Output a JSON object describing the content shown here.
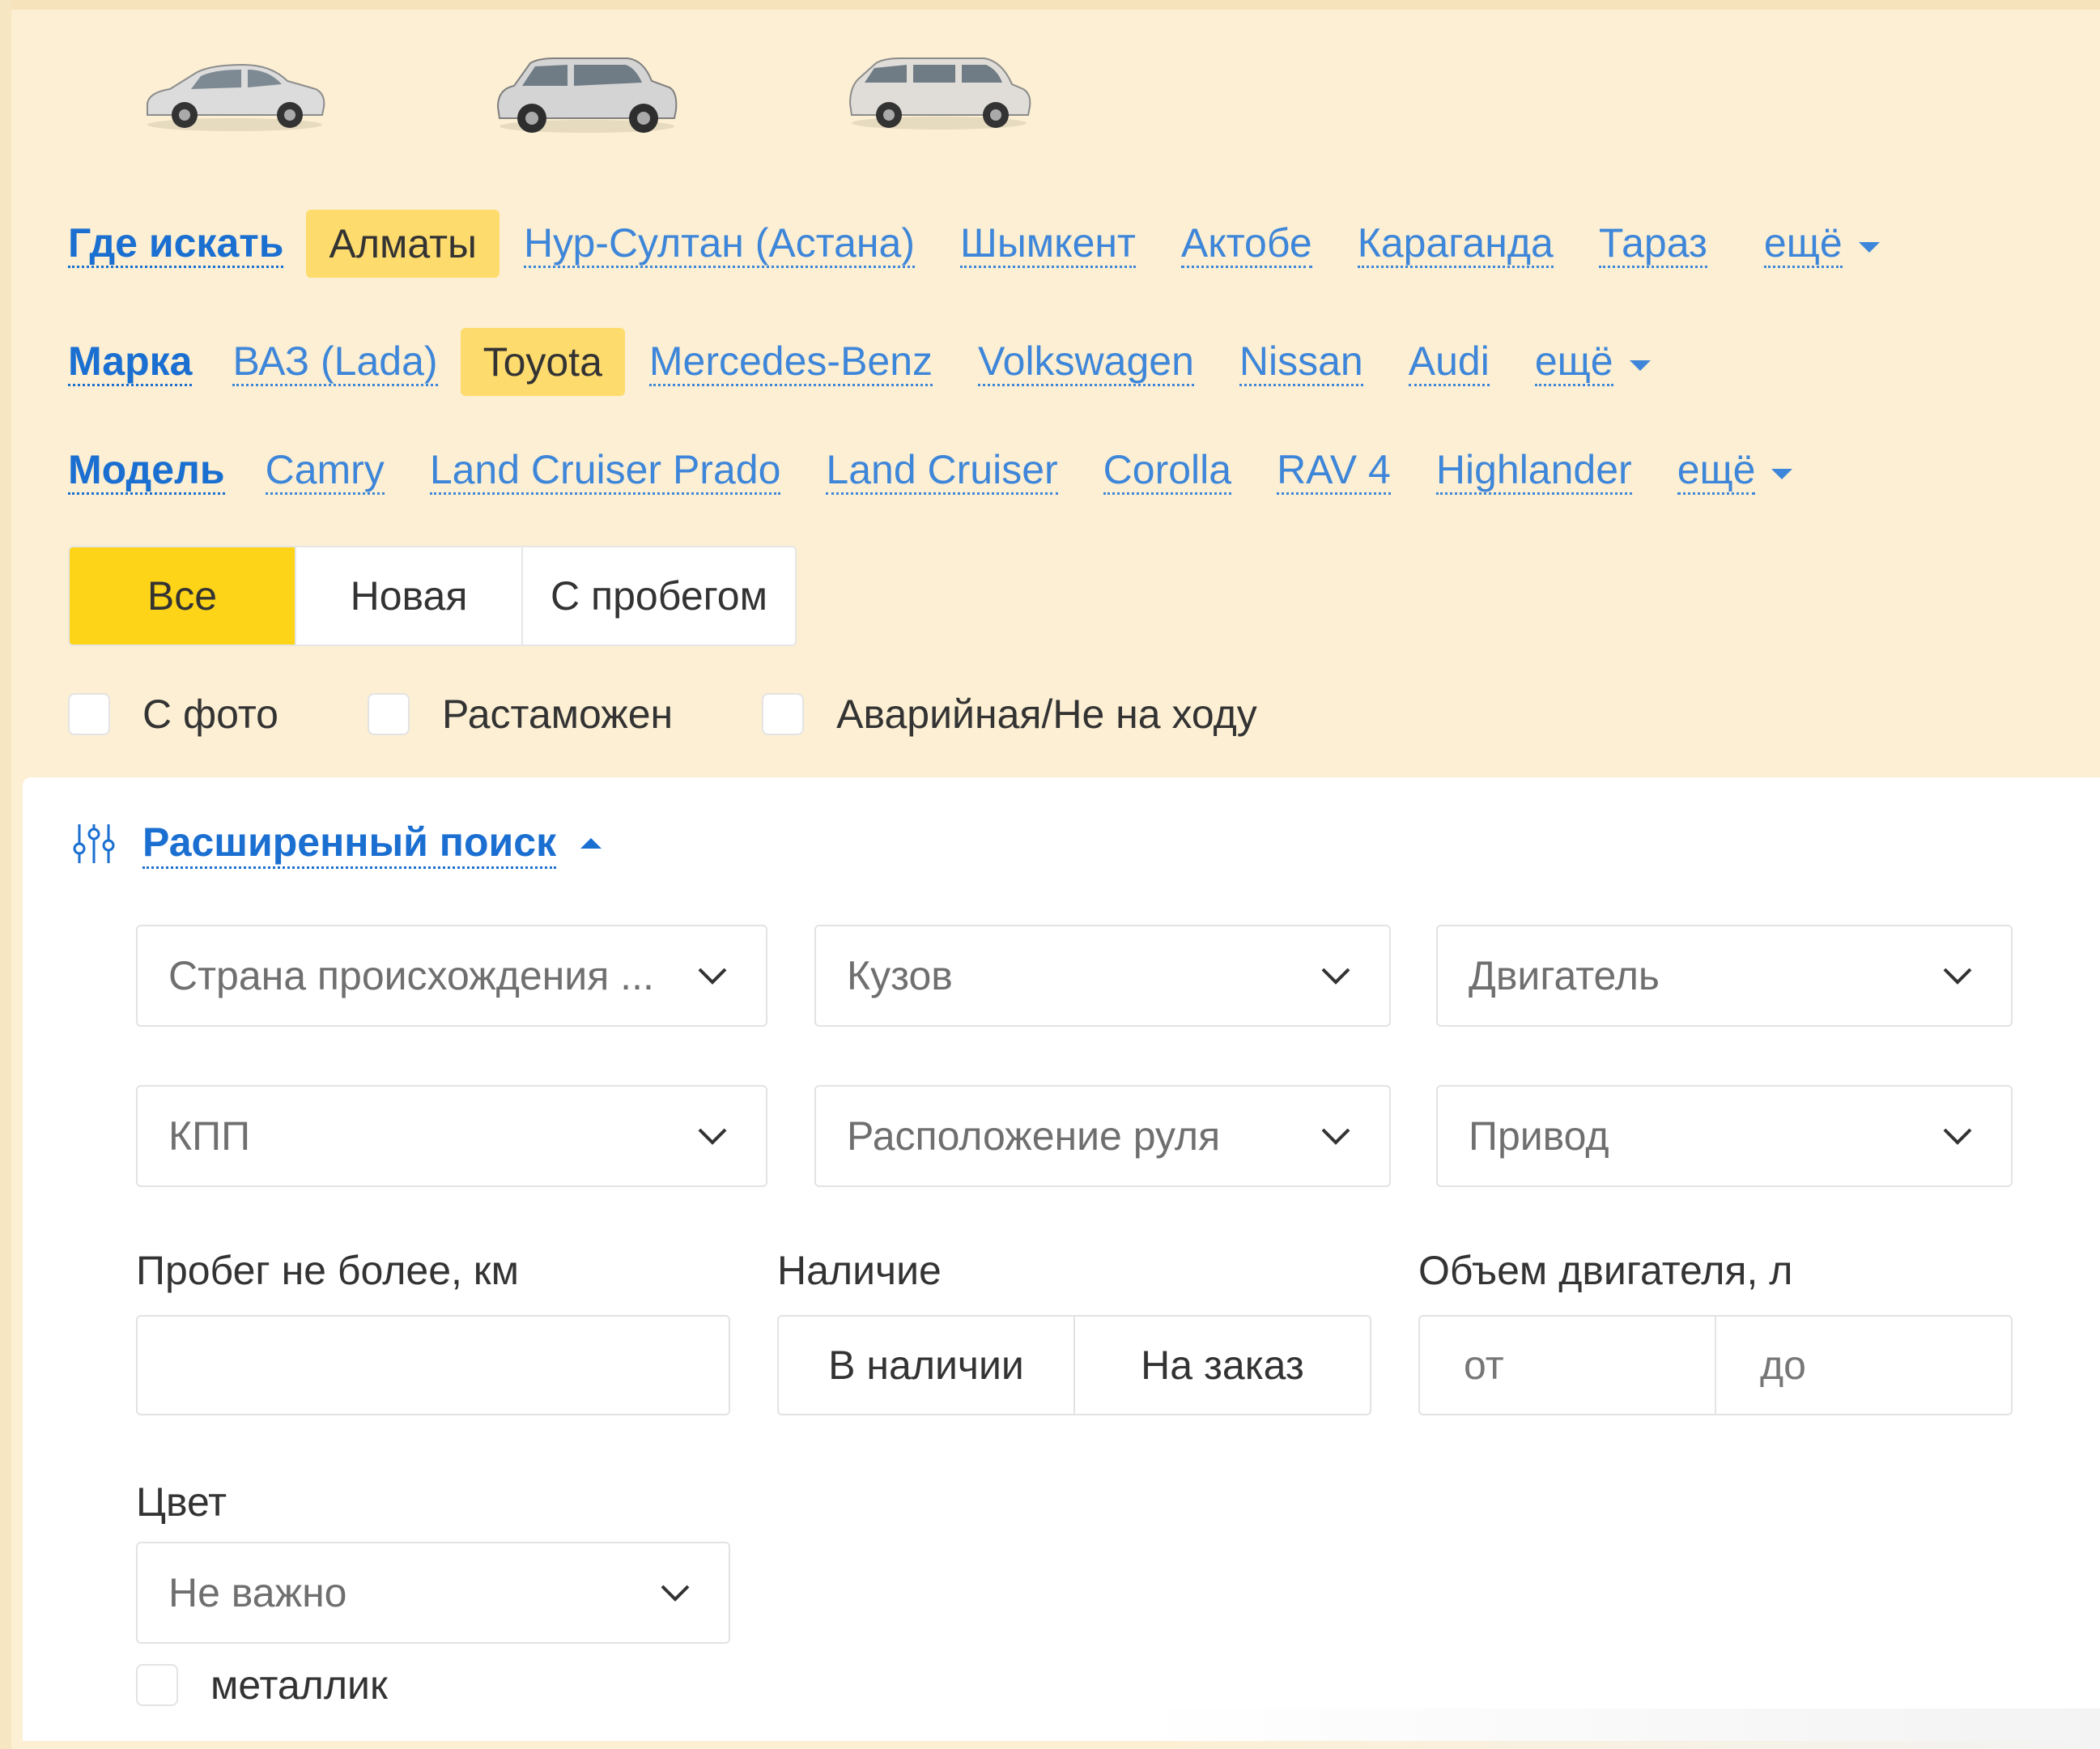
{
  "search": {
    "where_label": "Где искать",
    "cities": [
      "Алматы",
      "Нур-Султан (Астана)",
      "Шымкент",
      "Актобе",
      "Караганда",
      "Тараз"
    ],
    "cities_more": "ещё",
    "brand_label": "Марка",
    "brands": [
      "ВАЗ (Lada)",
      "Toyota",
      "Mercedes-Benz",
      "Volkswagen",
      "Nissan",
      "Audi"
    ],
    "brands_more": "ещё",
    "model_label": "Модель",
    "models": [
      "Camry",
      "Land Cruiser Prado",
      "Land Cruiser",
      "Corolla",
      "RAV 4",
      "Highlander"
    ],
    "models_more": "ещё",
    "condition": [
      "Все",
      "Новая",
      "С пробегом"
    ],
    "checkboxes": [
      "С фото",
      "Растаможен",
      "Аварийная/Не на ходу"
    ]
  },
  "advanced": {
    "title": "Расширенный поиск",
    "dropdowns": [
      "Страна происхождения ...",
      "Кузов",
      "Двигатель",
      "КПП",
      "Расположение руля",
      "Привод"
    ],
    "mileage_label": "Пробег не более, км",
    "mileage_value": "",
    "availability_label": "Наличие",
    "availability_options": [
      "В наличии",
      "На заказ"
    ],
    "engine_volume_label": "Объем двигателя, л",
    "engine_from_placeholder": "от",
    "engine_to_placeholder": "до",
    "color_label": "Цвет",
    "color_value": "Не важно",
    "metallic_label": "металлик"
  },
  "icons": [
    "sedan-car-icon",
    "suv-car-icon",
    "minivan-car-icon",
    "filter-sliders-icon",
    "chevron-down-icon"
  ],
  "colors": {
    "accent_yellow": "#fdd418",
    "chip_yellow": "#fedb6d",
    "link_blue": "#3e86d9",
    "label_blue": "#1a6fd1",
    "bg_cream": "#fcefd3"
  }
}
